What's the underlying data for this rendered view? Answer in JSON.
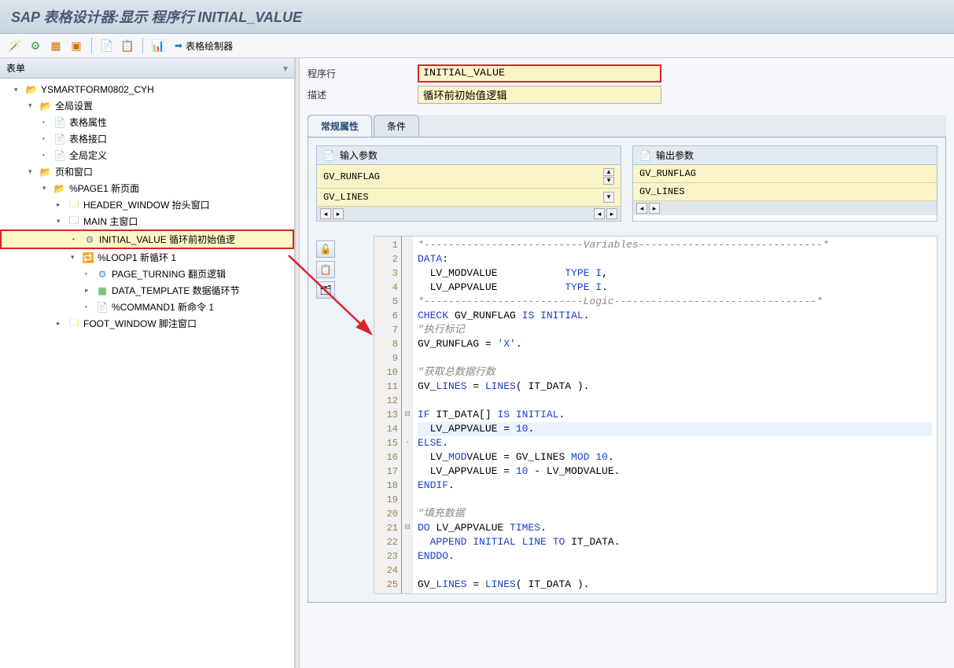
{
  "title": "SAP 表格设计器:显示 程序行 INITIAL_VALUE",
  "toolbar": {
    "painter": "表格绘制器",
    "icons": [
      "wand",
      "sort",
      "graph",
      "win",
      "page",
      "page2",
      "graph2"
    ]
  },
  "left": {
    "panel_title": "表单",
    "tree": [
      {
        "lvl": 0,
        "tw": "▾",
        "ico": "folder-open",
        "txt": "YSMARTFORM0802_CYH"
      },
      {
        "lvl": 1,
        "tw": "▾",
        "ico": "folder-open",
        "txt": "全局设置"
      },
      {
        "lvl": 2,
        "tw": "·",
        "ico": "page",
        "txt": "表格属性"
      },
      {
        "lvl": 2,
        "tw": "·",
        "ico": "page",
        "txt": "表格接口"
      },
      {
        "lvl": 2,
        "tw": "·",
        "ico": "page",
        "txt": "全局定义"
      },
      {
        "lvl": 1,
        "tw": "▾",
        "ico": "folder-open",
        "txt": "页和窗口"
      },
      {
        "lvl": 2,
        "tw": "▾",
        "ico": "folder-open",
        "txt": "%PAGE1 新页面"
      },
      {
        "lvl": 3,
        "tw": "▸",
        "ico": "win",
        "txt": "HEADER_WINDOW 抬头窗口"
      },
      {
        "lvl": 3,
        "tw": "▾",
        "ico": "mainwin",
        "txt": "MAIN 主窗口"
      },
      {
        "lvl": 4,
        "tw": "·",
        "ico": "gear",
        "txt": "INITIAL_VALUE 循环前初始值逻",
        "sel": true
      },
      {
        "lvl": 4,
        "tw": "▾",
        "ico": "loop",
        "txt": "%LOOP1 新循环 1"
      },
      {
        "lvl": 5,
        "tw": "·",
        "ico": "gear",
        "txt": "PAGE_TURNING 翻页逻辑"
      },
      {
        "lvl": 5,
        "tw": "▸",
        "ico": "grid",
        "txt": "DATA_TEMPLATE 数据循环节"
      },
      {
        "lvl": 5,
        "tw": "·",
        "ico": "page",
        "txt": "%COMMAND1 新命令 1"
      },
      {
        "lvl": 3,
        "tw": "▸",
        "ico": "win",
        "txt": "FOOT_WINDOW 脚注窗口"
      }
    ]
  },
  "right": {
    "fields": {
      "prog_label": "程序行",
      "prog_value": "INITIAL_VALUE",
      "desc_label": "描述",
      "desc_value": "循环前初始值逻辑"
    },
    "tabs": {
      "active": "常规属性",
      "other": "条件"
    },
    "params": {
      "in_hdr": "输入参数",
      "out_hdr": "输出参数",
      "in_vals": [
        "GV_RUNFLAG",
        "GV_LINES"
      ],
      "out_vals": [
        "GV_RUNFLAG",
        "GV_LINES"
      ]
    }
  },
  "code": [
    {
      "n": 1,
      "t": "*--------------------------",
      "c": "cm",
      "suffix": "Variables",
      "dash": "------------------------------*"
    },
    {
      "n": 2,
      "t": "DATA:",
      "kw": [
        "DATA"
      ]
    },
    {
      "n": 3,
      "t": "  LV_MODVALUE           TYPE I,",
      "kw": [
        "TYPE",
        "I"
      ]
    },
    {
      "n": 4,
      "t": "  LV_APPVALUE           TYPE I.",
      "kw": [
        "TYPE",
        "I"
      ]
    },
    {
      "n": 5,
      "t": "*--------------------------",
      "c": "cm",
      "suffix": "Logic",
      "dash": "---------------------------------*"
    },
    {
      "n": 6,
      "t": "CHECK GV_RUNFLAG IS INITIAL.",
      "kw": [
        "CHECK",
        "IS",
        "INITIAL"
      ]
    },
    {
      "n": 7,
      "t": "\"执行标记",
      "c": "cm"
    },
    {
      "n": 8,
      "t": "GV_RUNFLAG = 'X'.",
      "kw": [
        "'X'"
      ]
    },
    {
      "n": 9,
      "t": ""
    },
    {
      "n": 10,
      "t": "\"获取总数据行数",
      "c": "cm"
    },
    {
      "n": 11,
      "t": "GV_LINES = LINES( IT_DATA ).",
      "kw": [
        "LINES"
      ]
    },
    {
      "n": 12,
      "t": ""
    },
    {
      "n": 13,
      "t": "IF IT_DATA[] IS INITIAL.",
      "kw": [
        "IF",
        "IS",
        "INITIAL"
      ],
      "fold": "⊟"
    },
    {
      "n": 14,
      "t": "  LV_APPVALUE = 10.",
      "kw": [
        "10"
      ],
      "hl": true
    },
    {
      "n": 15,
      "t": "ELSE.",
      "kw": [
        "ELSE"
      ],
      "fold": "◦"
    },
    {
      "n": 16,
      "t": "  LV_MODVALUE = GV_LINES MOD 10.",
      "kw": [
        "MOD",
        "10"
      ]
    },
    {
      "n": 17,
      "t": "  LV_APPVALUE = 10 - LV_MODVALUE.",
      "kw": [
        "10"
      ]
    },
    {
      "n": 18,
      "t": "ENDIF.",
      "kw": [
        "ENDIF"
      ]
    },
    {
      "n": 19,
      "t": ""
    },
    {
      "n": 20,
      "t": "\"填充数据",
      "c": "cm"
    },
    {
      "n": 21,
      "t": "DO LV_APPVALUE TIMES.",
      "kw": [
        "DO",
        "TIMES"
      ],
      "fold": "⊟"
    },
    {
      "n": 22,
      "t": "  APPEND INITIAL LINE TO IT_DATA.",
      "kw": [
        "APPEND",
        "INITIAL",
        "LINE",
        "TO"
      ]
    },
    {
      "n": 23,
      "t": "ENDDO.",
      "kw": [
        "ENDDO"
      ]
    },
    {
      "n": 24,
      "t": ""
    },
    {
      "n": 25,
      "t": "GV_LINES = LINES( IT_DATA ).",
      "kw": [
        "LINES"
      ]
    }
  ]
}
